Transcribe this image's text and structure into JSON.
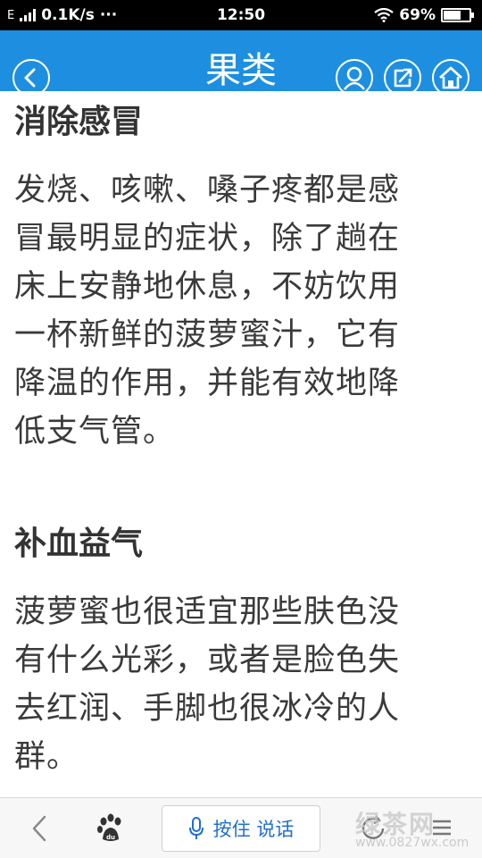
{
  "status_bar": {
    "carrier_icon": "E",
    "speed": "0.1K/s",
    "more": "···",
    "time": "12:50",
    "battery_percent": "69%",
    "battery_level": 0.69
  },
  "header": {
    "title": "果类",
    "back_icon": "chevron-left-icon",
    "user_icon": "user-icon",
    "share_icon": "share-icon",
    "home_icon": "home-icon",
    "color": "#1e8fe0"
  },
  "article": {
    "sections": [
      {
        "heading": "消除感冒",
        "lines": [
          "发烧、咳嗽、嗓子疼都是感",
          "冒最明显的症状，除了趟在",
          "床上安静地休息，不妨饮用",
          "一杯新鲜的菠萝蜜汁，它有",
          "降温的作用，并能有效地降",
          "低支气管。"
        ]
      },
      {
        "heading": "补血益气",
        "lines": [
          "菠萝蜜也很适宜那些肤色没",
          "有什么光彩，或者是脸色失",
          "去红润、手脚也很冰冷的人",
          "群。"
        ]
      }
    ]
  },
  "bottom_bar": {
    "back_icon": "chevron-left-icon",
    "paw_icon": "paw-icon",
    "voice_label": "按住 说话",
    "mic_icon": "microphone-icon",
    "refresh_icon": "refresh-icon",
    "watermark": "绿茶网",
    "watermark_url": "www.0827wx.com"
  }
}
